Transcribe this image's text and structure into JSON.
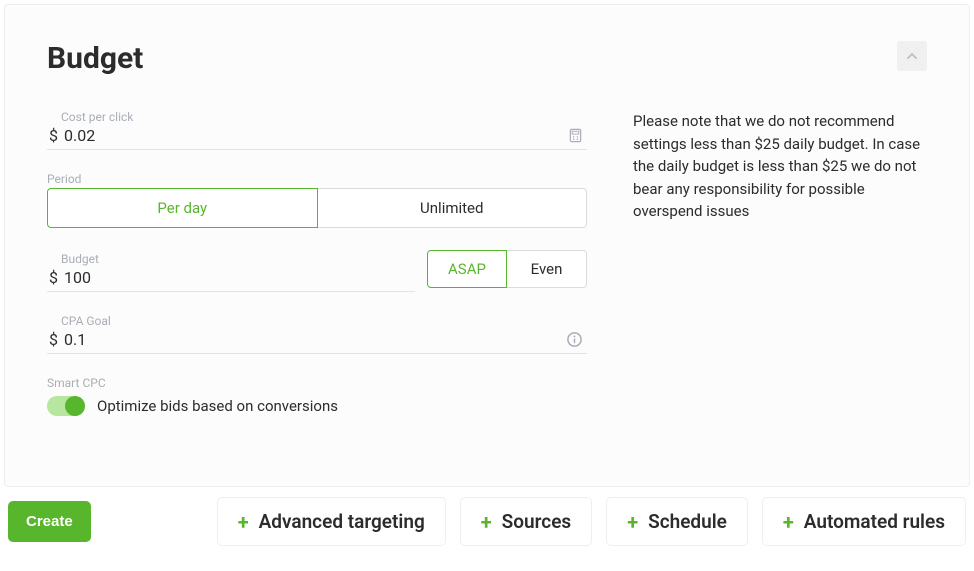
{
  "panel": {
    "title": "Budget",
    "note": "Please note that we do not recommend settings less than $25 daily budget. In case the daily budget is less than $25 we do not bear any responsibility for possible overspend issues"
  },
  "fields": {
    "cpc": {
      "label": "Cost per click",
      "prefix": "$",
      "value": "0.02"
    },
    "period": {
      "label": "Period",
      "options": {
        "perDay": "Per day",
        "unlimited": "Unlimited"
      },
      "selected": "perDay"
    },
    "budget": {
      "label": "Budget",
      "prefix": "$",
      "value": "100",
      "distribution": {
        "asap": "ASAP",
        "even": "Even",
        "selected": "asap"
      }
    },
    "cpa": {
      "label": "CPA Goal",
      "prefix": "$",
      "value": "0.1"
    },
    "smartCpc": {
      "label": "Smart CPC",
      "description": "Optimize bids based on conversions",
      "enabled": true
    }
  },
  "footer": {
    "create": "Create",
    "tabs": {
      "targeting": "Advanced targeting",
      "sources": "Sources",
      "schedule": "Schedule",
      "rules": "Automated rules"
    }
  }
}
